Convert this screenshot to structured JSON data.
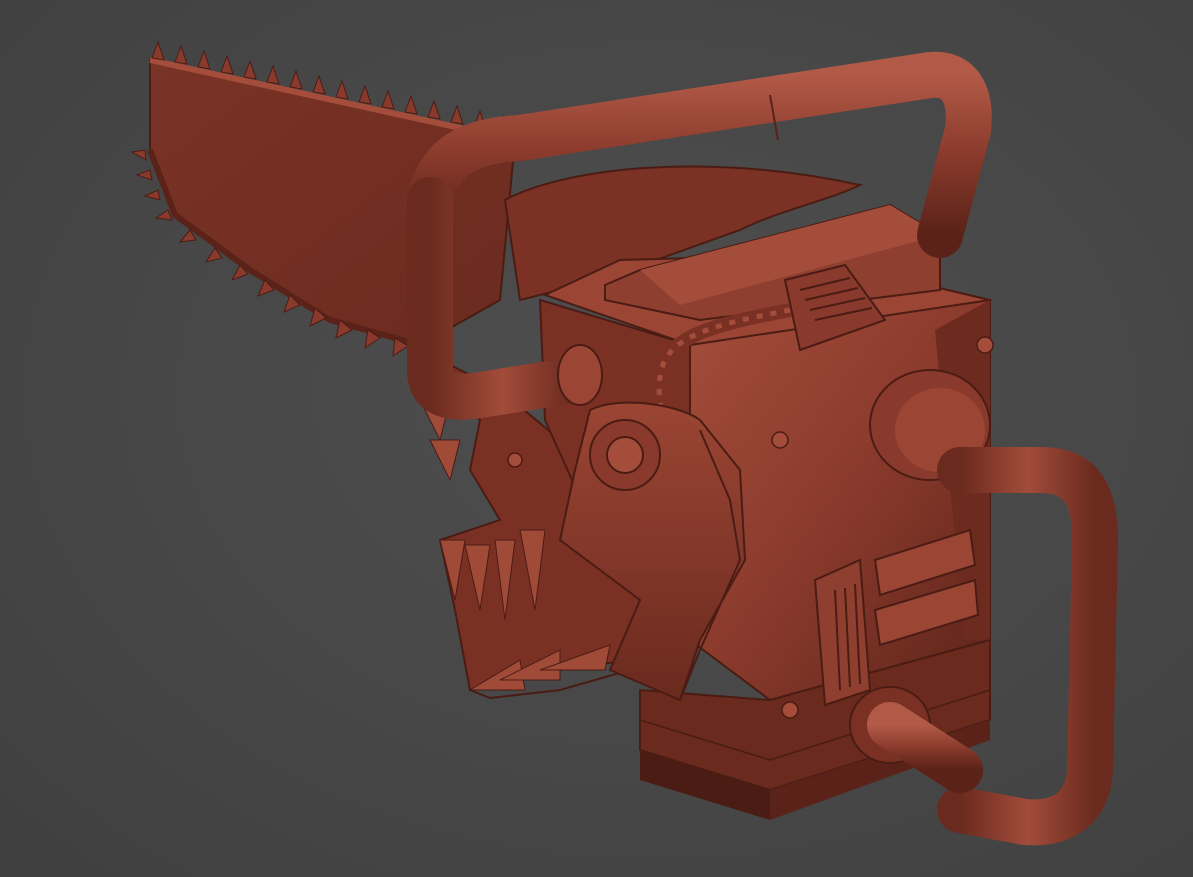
{
  "scene": {
    "subject": "chainsaw-head-sculpt",
    "background_color": "#454545",
    "material_color": "#8a3a2c",
    "material_highlight": "#b25a48",
    "material_shadow": "#4a1c14"
  }
}
